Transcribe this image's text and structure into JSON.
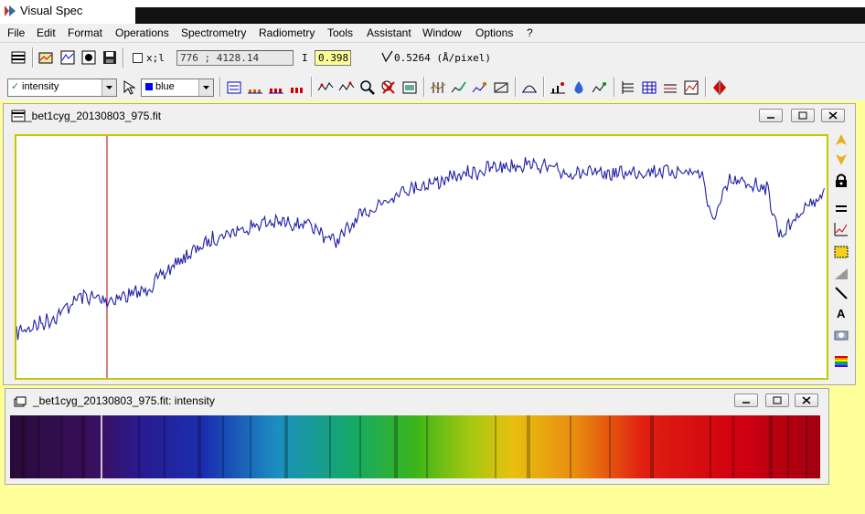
{
  "app": {
    "title": "Visual Spec"
  },
  "menu": [
    "File",
    "Edit",
    "Format",
    "Operations",
    "Spectrometry",
    "Radiometry",
    "Tools",
    "Assistant",
    "Window",
    "Options",
    "?"
  ],
  "toolbar1": {
    "xl_label": "x;l",
    "coord_value": "776 ; 4128.14",
    "i_label": "I",
    "i_value": "0.398",
    "dispersion_text": "0.5264 (Å/pixel)"
  },
  "toolbar2": {
    "profile_select": "intensity",
    "color_select": "blue"
  },
  "profile_window": {
    "title": "_bet1cyg_20130803_975.fit",
    "line_color": "#1f1fa8",
    "cursor_color": "#b00000"
  },
  "spectrum_window": {
    "title": "_bet1cyg_20130803_975.fit: intensity"
  },
  "icons": {
    "toolbar1": [
      "layers-icon",
      "open-icon",
      "open-profile-icon",
      "open-image-icon",
      "save-icon"
    ],
    "toolbar2": [
      "select-icon",
      "zoom-profile-icon",
      "display-icon",
      "multi-display-icon",
      "peak-icon",
      "calibrate-icon",
      "zoom-icon",
      "remove-icon",
      "image-icon",
      "lines-icon",
      "edit-icon",
      "smooth-icon",
      "measure-icon",
      "fit-icon",
      "continuum-icon",
      "water-icon",
      "nlines-icon",
      "grid-icon",
      "table-icon",
      "levels-icon",
      "frame-icon",
      "pause-icon"
    ],
    "vertical": [
      "arrow-up-icon",
      "arrow-down-icon",
      "lock-icon",
      "equal-icon",
      "graph-icon",
      "box-icon",
      "gradient-icon",
      "line-tool-icon",
      "text-tool-icon",
      "camera-icon",
      "palette-icon"
    ]
  }
}
